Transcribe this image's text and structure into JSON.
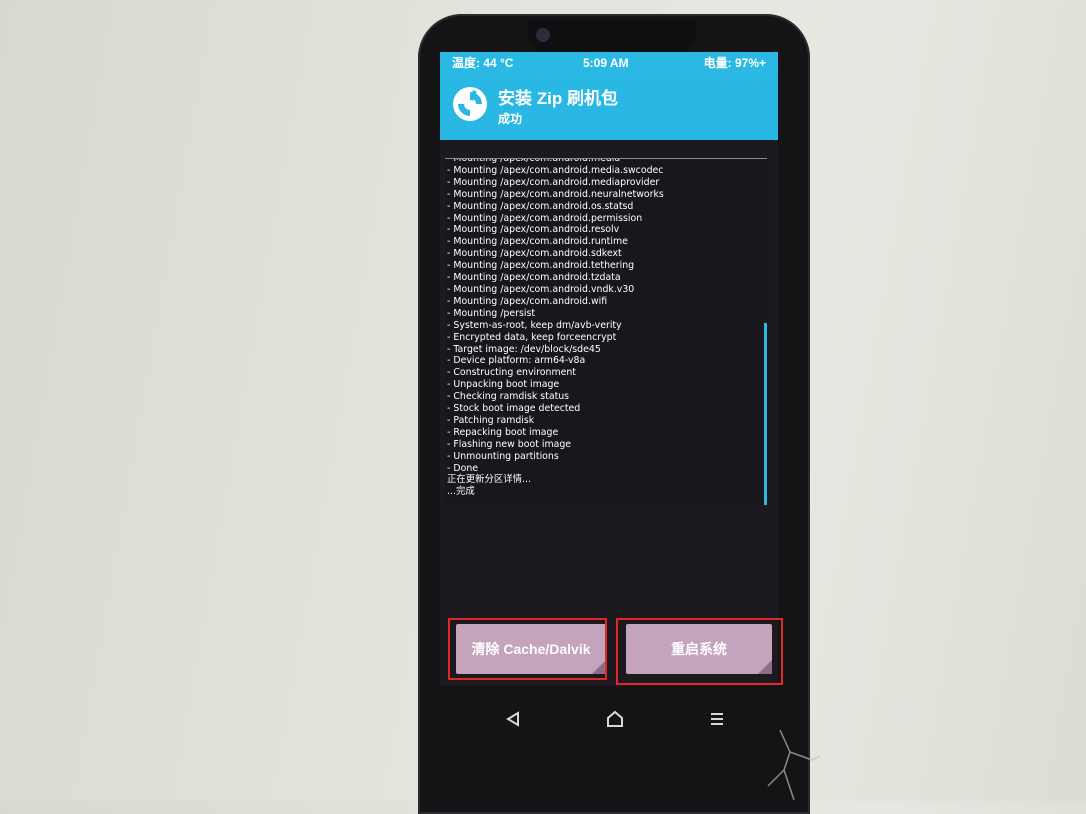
{
  "status_bar": {
    "temperature": "温度: 44 °C",
    "time": "5:09 AM",
    "battery": "电量: 97%+"
  },
  "header": {
    "logo": "twrp-logo-icon",
    "title": "安装 Zip 刷机包",
    "subtitle": "成功"
  },
  "console": {
    "lines": [
      "- Mounting /apex/com.android.media",
      "- Mounting /apex/com.android.media.swcodec",
      "- Mounting /apex/com.android.mediaprovider",
      "- Mounting /apex/com.android.neuralnetworks",
      "- Mounting /apex/com.android.os.statsd",
      "- Mounting /apex/com.android.permission",
      "- Mounting /apex/com.android.resolv",
      "- Mounting /apex/com.android.runtime",
      "- Mounting /apex/com.android.sdkext",
      "- Mounting /apex/com.android.tethering",
      "- Mounting /apex/com.android.tzdata",
      "- Mounting /apex/com.android.vndk.v30",
      "- Mounting /apex/com.android.wifi",
      "- Mounting /persist",
      "- System-as-root, keep dm/avb-verity",
      "- Encrypted data, keep forceencrypt",
      "- Target image: /dev/block/sde45",
      "- Device platform: arm64-v8a",
      "- Constructing environment",
      "- Unpacking boot image",
      "- Checking ramdisk status",
      "- Stock boot image detected",
      "- Patching ramdisk",
      "- Repacking boot image",
      "- Flashing new boot image",
      "- Unmounting partitions",
      "- Done",
      "正在更新分区详情...",
      "...完成"
    ]
  },
  "buttons": {
    "wipe_cache_dalvik": "清除 Cache/Dalvik",
    "reboot_system": "重启系统"
  },
  "nav_bar": {
    "back": "back-icon",
    "home": "home-icon",
    "menu": "menu-icon"
  },
  "colors": {
    "accent": "#2bb8e3",
    "button": "#c4a3bd",
    "highlight": "#e32727"
  }
}
